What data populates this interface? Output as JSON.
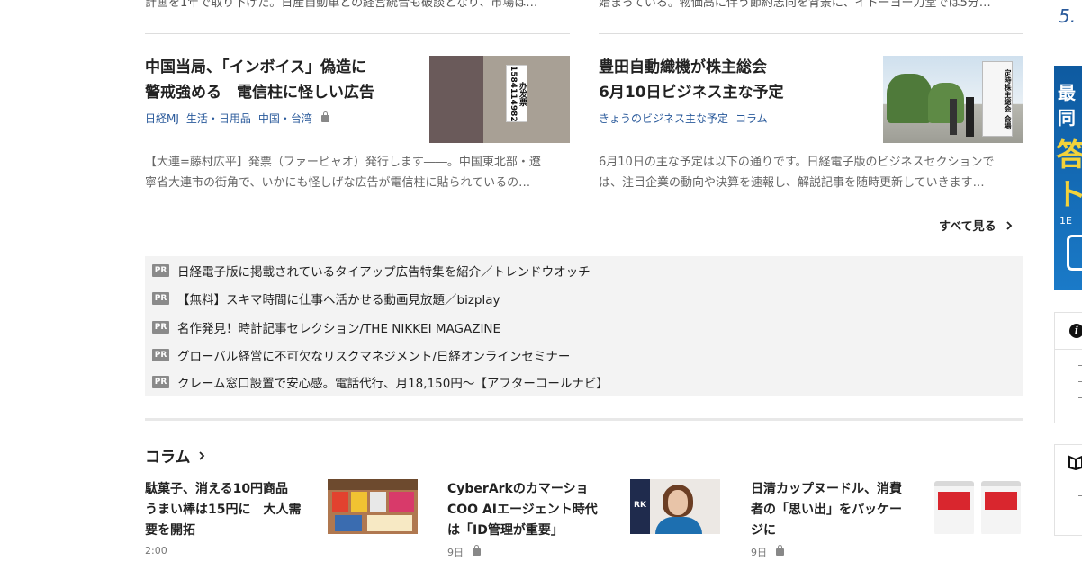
{
  "top_snippets": {
    "left": "計画を1年で取り下げた。日産自動車との経営統合も破談となり、市場は…",
    "right": "始まっている。物価高に伴う節約志向を背景に、イトーヨー力堂では5分…"
  },
  "articles": [
    {
      "title_line1": "中国当局、「インボイス」偽造に",
      "title_line2": "警戒強める　電信柱に怪しい広告",
      "tags": [
        "日経MJ",
        "生活・日用品",
        "中国・台湾"
      ],
      "desc_line1": "【大連=藤村広平】発票（ファーピャオ）発行します――。中国東北部・遼",
      "desc_line2": "寧省大連市の街角で、いかにも怪しげな広告が電信柱に貼られているの…",
      "photo_sign": "办发票 15841149820"
    },
    {
      "title_line1": "豊田自動織機が株主総会",
      "title_line2": "6月10日ビジネス主な予定",
      "tags": [
        "きょうのビジネス主な予定",
        "コラム"
      ],
      "desc_line1": "6月10日の主な予定は以下の通りです。日経電子版のビジネスセクションで",
      "desc_line2": "は、注目企業の動向や決算を速報し、解説記事を随時更新していきます…",
      "photo_sign": "定時株主総会 会場"
    }
  ],
  "see_all": "すべて見る",
  "pr": {
    "badge": "PR",
    "items": [
      "日経電子版に掲載されているタイアップ広告特集を紹介／トレンドウオッチ",
      "【無料】スキマ時間に仕事へ活かせる動画見放題／bizplay",
      "名作発見！時計記事セレクション/THE NIKKEI MAGAZINE",
      "グローバル経営に不可欠なリスクマネジメント/日経オンラインセミナー",
      "クレーム窓口設置で安心感。電話代行、月18,150円～【アフターコールナビ】"
    ]
  },
  "column": {
    "title": "コラム",
    "items": [
      {
        "line1": "駄菓子、消える10円商品",
        "line2": "うまい棒は15円に　大人需",
        "line3": "要を開拓",
        "meta": "2:00",
        "locked": false
      },
      {
        "line1": "CyberArkのカマーショ",
        "line2": "COO AIエージェント時代",
        "line3": "は「ID管理が重要」",
        "meta": "9日",
        "locked": true,
        "photo_text": "RK"
      },
      {
        "line1": "日清カップヌードル、消費",
        "line2": "者の「思い出」をパッケー",
        "line3": "ジに",
        "meta": "9日",
        "locked": true
      }
    ]
  },
  "right_rail": {
    "rank_number": "5.",
    "ad_chars": [
      "最",
      "同",
      "答",
      "ト",
      "1E"
    ]
  },
  "colors": {
    "link_blue": "#2a5a9b",
    "pr_bg": "#f3f3f3",
    "ad_blue": "#1a6bb5"
  }
}
